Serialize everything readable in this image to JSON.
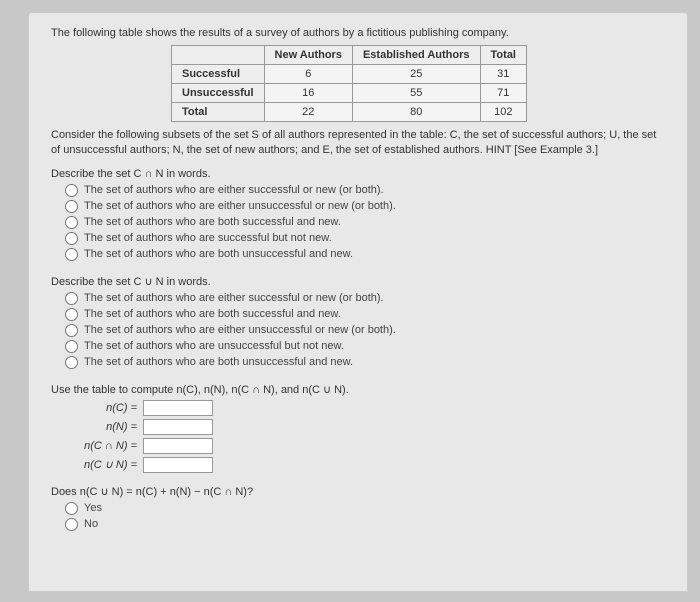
{
  "intro": "The following table shows the results of a survey of authors by a fictitious publishing company.",
  "table": {
    "col_blank": "",
    "col1": "New Authors",
    "col2": "Established Authors",
    "col3": "Total",
    "rows": [
      {
        "hdr": "Successful",
        "c1": "6",
        "c2": "25",
        "c3": "31"
      },
      {
        "hdr": "Unsuccessful",
        "c1": "16",
        "c2": "55",
        "c3": "71"
      },
      {
        "hdr": "Total",
        "c1": "22",
        "c2": "80",
        "c3": "102"
      }
    ]
  },
  "consider": "Consider the following subsets of the set S of all authors represented in the table: C, the set of successful authors; U, the set of unsuccessful authors; N, the set of new authors; and E, the set of established authors. HINT [See Example 3.]",
  "q1": {
    "label": "Describe the set C ∩ N in words.",
    "opts": [
      "The set of authors who are either successful or new (or both).",
      "The set of authors who are either unsuccessful or new (or both).",
      "The set of authors who are both successful and new.",
      "The set of authors who are successful but not new.",
      "The set of authors who are both unsuccessful and new."
    ]
  },
  "q2": {
    "label": "Describe the set C ∪ N in words.",
    "opts": [
      "The set of authors who are either successful or new (or both).",
      "The set of authors who are both successful and new.",
      "The set of authors who are either unsuccessful or new (or both).",
      "The set of authors who are unsuccessful but not new.",
      "The set of authors who are both unsuccessful and new."
    ]
  },
  "compute": {
    "label": "Use the table to compute n(C), n(N), n(C ∩ N), and n(C ∪ N).",
    "rows": [
      "n(C) =",
      "n(N) =",
      "n(C ∩ N) =",
      "n(C ∪ N) ="
    ]
  },
  "final": {
    "label": "Does n(C ∪ N) = n(C) + n(N) − n(C ∩ N)?",
    "yes": "Yes",
    "no": "No"
  }
}
